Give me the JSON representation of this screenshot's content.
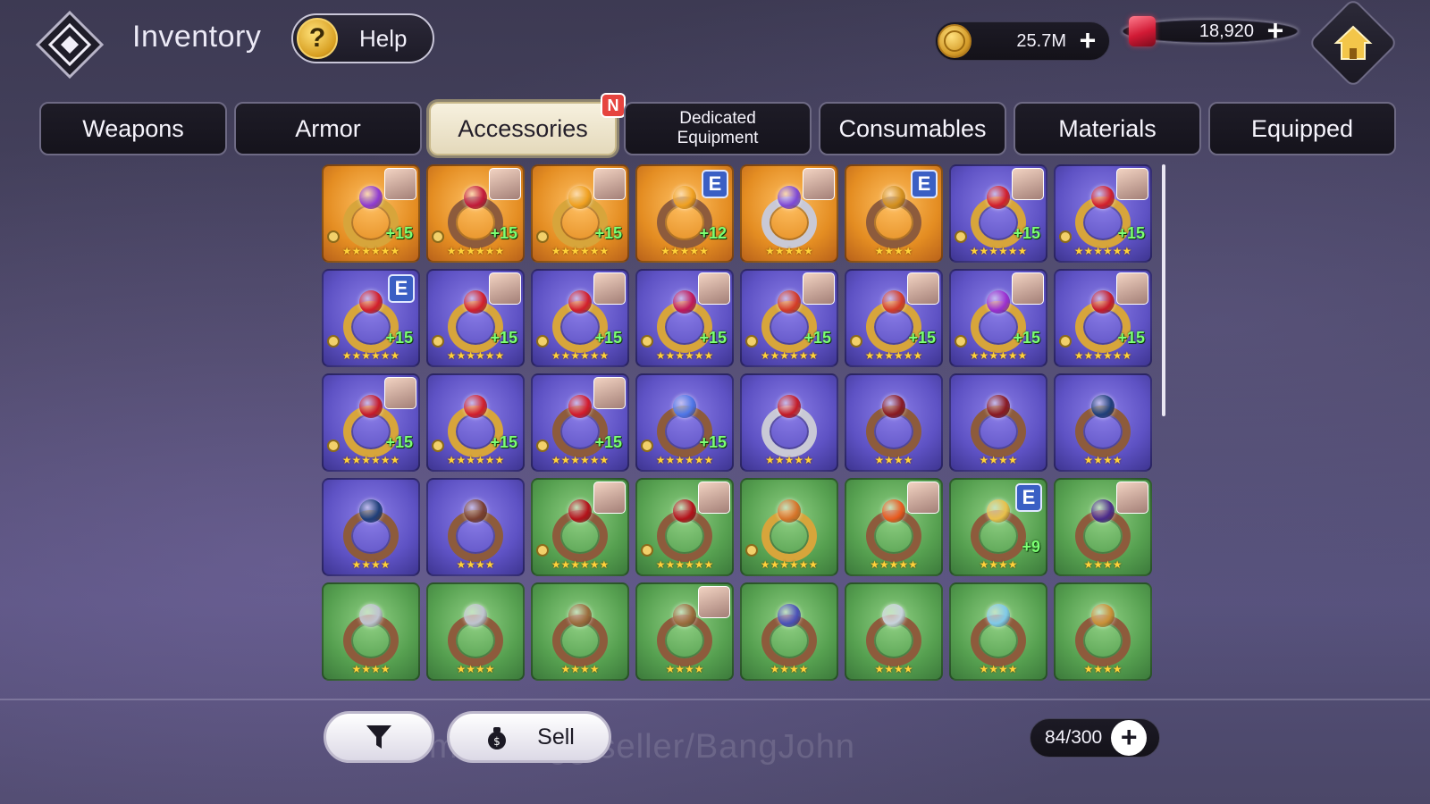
{
  "header": {
    "title": "Inventory",
    "help_label": "Help",
    "gold_amount": "25.7M",
    "gem_amount": "18,920",
    "plus": "+"
  },
  "tabs": [
    {
      "label": "Weapons",
      "active": false
    },
    {
      "label": "Armor",
      "active": false
    },
    {
      "label": "Accessories",
      "active": true,
      "badge": "N"
    },
    {
      "label": "Dedicated Equipment",
      "active": false
    },
    {
      "label": "Consumables",
      "active": false
    },
    {
      "label": "Materials",
      "active": false
    },
    {
      "label": "Equipped",
      "active": false
    }
  ],
  "items": [
    {
      "bg": "orange",
      "ring": "gold",
      "gem": "#8e3ad1",
      "level": "+15",
      "stars": "★★★★★★",
      "portrait": true,
      "e": false
    },
    {
      "bg": "orange",
      "ring": "dark",
      "gem": "#c21a3a",
      "level": "+15",
      "stars": "★★★★★★",
      "portrait": true,
      "e": false
    },
    {
      "bg": "orange",
      "ring": "gold",
      "gem": "#f0a020",
      "level": "+15",
      "stars": "★★★★★★",
      "portrait": true,
      "e": false
    },
    {
      "bg": "orange",
      "ring": "dark",
      "gem": "#f0a020",
      "level": "+12",
      "stars": "★★★★★",
      "portrait": false,
      "e": true
    },
    {
      "bg": "orange",
      "ring": "silver",
      "gem": "#7d49d6",
      "level": "",
      "stars": "★★★★★",
      "portrait": true,
      "e": false
    },
    {
      "bg": "orange",
      "ring": "dark",
      "gem": "#d4901e",
      "level": "",
      "stars": "★★★★",
      "portrait": false,
      "e": true
    },
    {
      "bg": "purple",
      "ring": "gold",
      "gem": "#d21f2c",
      "level": "+15",
      "stars": "★★★★★★",
      "portrait": true,
      "e": false
    },
    {
      "bg": "purple",
      "ring": "gold",
      "gem": "#d21f2c",
      "level": "+15",
      "stars": "★★★★★★",
      "portrait": true,
      "e": false
    },
    {
      "bg": "purple",
      "ring": "gold",
      "gem": "#d21f2c",
      "level": "+15",
      "stars": "★★★★★★",
      "portrait": false,
      "e": true
    },
    {
      "bg": "purple",
      "ring": "gold",
      "gem": "#d21f2c",
      "level": "+15",
      "stars": "★★★★★★",
      "portrait": true,
      "e": false
    },
    {
      "bg": "purple",
      "ring": "gold",
      "gem": "#d21f2c",
      "level": "+15",
      "stars": "★★★★★★",
      "portrait": true,
      "e": false
    },
    {
      "bg": "purple",
      "ring": "gold",
      "gem": "#c0185a",
      "level": "+15",
      "stars": "★★★★★★",
      "portrait": true,
      "e": false
    },
    {
      "bg": "purple",
      "ring": "gold",
      "gem": "#d43b28",
      "level": "+15",
      "stars": "★★★★★★",
      "portrait": true,
      "e": false
    },
    {
      "bg": "purple",
      "ring": "gold",
      "gem": "#d43b28",
      "level": "+15",
      "stars": "★★★★★★",
      "portrait": true,
      "e": false
    },
    {
      "bg": "purple",
      "ring": "gold",
      "gem": "#9b2fd0",
      "level": "+15",
      "stars": "★★★★★★",
      "portrait": true,
      "e": false
    },
    {
      "bg": "purple",
      "ring": "gold",
      "gem": "#c51a2a",
      "level": "+15",
      "stars": "★★★★★★",
      "portrait": true,
      "e": false
    },
    {
      "bg": "purple",
      "ring": "gold",
      "gem": "#c51a2a",
      "level": "+15",
      "stars": "★★★★★★",
      "portrait": true,
      "e": false
    },
    {
      "bg": "purple",
      "ring": "gold",
      "gem": "#d21f2c",
      "level": "+15",
      "stars": "★★★★★★",
      "portrait": false,
      "e": false
    },
    {
      "bg": "purple",
      "ring": "dark",
      "gem": "#d31b2c",
      "level": "+15",
      "stars": "★★★★★★",
      "portrait": true,
      "e": false
    },
    {
      "bg": "purple",
      "ring": "dark",
      "gem": "#4e76e8",
      "level": "+15",
      "stars": "★★★★★★",
      "portrait": false,
      "e": false
    },
    {
      "bg": "purple",
      "ring": "silver",
      "gem": "#c41b26",
      "level": "",
      "stars": "★★★★★",
      "portrait": false,
      "e": false
    },
    {
      "bg": "purple",
      "ring": "dark",
      "gem": "#8a1a22",
      "level": "",
      "stars": "★★★★",
      "portrait": false,
      "e": false
    },
    {
      "bg": "purple",
      "ring": "dark",
      "gem": "#8a1a22",
      "level": "",
      "stars": "★★★★",
      "portrait": false,
      "e": false
    },
    {
      "bg": "purple",
      "ring": "dark",
      "gem": "#1f3f7a",
      "level": "",
      "stars": "★★★★",
      "portrait": false,
      "e": false
    },
    {
      "bg": "purple",
      "ring": "dark",
      "gem": "#1f3f7a",
      "level": "",
      "stars": "★★★★",
      "portrait": false,
      "e": false
    },
    {
      "bg": "purple",
      "ring": "dark",
      "gem": "#7a4030",
      "level": "",
      "stars": "★★★★",
      "portrait": false,
      "e": false
    },
    {
      "bg": "green",
      "ring": "dark",
      "gem": "#b3121a",
      "level": "",
      "stars": "★★★★★★",
      "portrait": true,
      "e": false
    },
    {
      "bg": "green",
      "ring": "dark",
      "gem": "#b3121a",
      "level": "",
      "stars": "★★★★★★",
      "portrait": true,
      "e": false
    },
    {
      "bg": "green",
      "ring": "gold",
      "gem": "#d6742a",
      "level": "",
      "stars": "★★★★★★",
      "portrait": false,
      "e": false
    },
    {
      "bg": "green",
      "ring": "dark",
      "gem": "#e85a1e",
      "level": "",
      "stars": "★★★★★",
      "portrait": true,
      "e": false
    },
    {
      "bg": "green",
      "ring": "dark",
      "gem": "#e8c04a",
      "level": "+9",
      "stars": "★★★★",
      "portrait": false,
      "e": true
    },
    {
      "bg": "green",
      "ring": "dark",
      "gem": "#4a2a8a",
      "level": "",
      "stars": "★★★★",
      "portrait": true,
      "e": false
    },
    {
      "bg": "green",
      "ring": "dark",
      "gem": "#bfc3cf",
      "level": "",
      "stars": "★★★★",
      "portrait": false,
      "e": false
    },
    {
      "bg": "green",
      "ring": "dark",
      "gem": "#bfc3cf",
      "level": "",
      "stars": "★★★★",
      "portrait": false,
      "e": false
    },
    {
      "bg": "green",
      "ring": "dark",
      "gem": "#9a6b3c",
      "level": "",
      "stars": "★★★★",
      "portrait": false,
      "e": false
    },
    {
      "bg": "green",
      "ring": "dark",
      "gem": "#9a6b3c",
      "level": "",
      "stars": "★★★★",
      "portrait": true,
      "e": false
    },
    {
      "bg": "green",
      "ring": "dark",
      "gem": "#4a50b8",
      "level": "",
      "stars": "★★★★",
      "portrait": false,
      "e": false
    },
    {
      "bg": "green",
      "ring": "dark",
      "gem": "#c8d3dc",
      "level": "",
      "stars": "★★★★",
      "portrait": false,
      "e": false
    },
    {
      "bg": "green",
      "ring": "dark",
      "gem": "#7fc9e8",
      "level": "",
      "stars": "★★★★",
      "portrait": false,
      "e": false
    },
    {
      "bg": "green",
      "ring": "dark",
      "gem": "#c99036",
      "level": "",
      "stars": "★★★★",
      "portrait": false,
      "e": false
    }
  ],
  "e_badge": "E",
  "bottom": {
    "sell_label": "Sell",
    "capacity": "84/300",
    "watermark": "market.gg/seller/BangJohn"
  }
}
